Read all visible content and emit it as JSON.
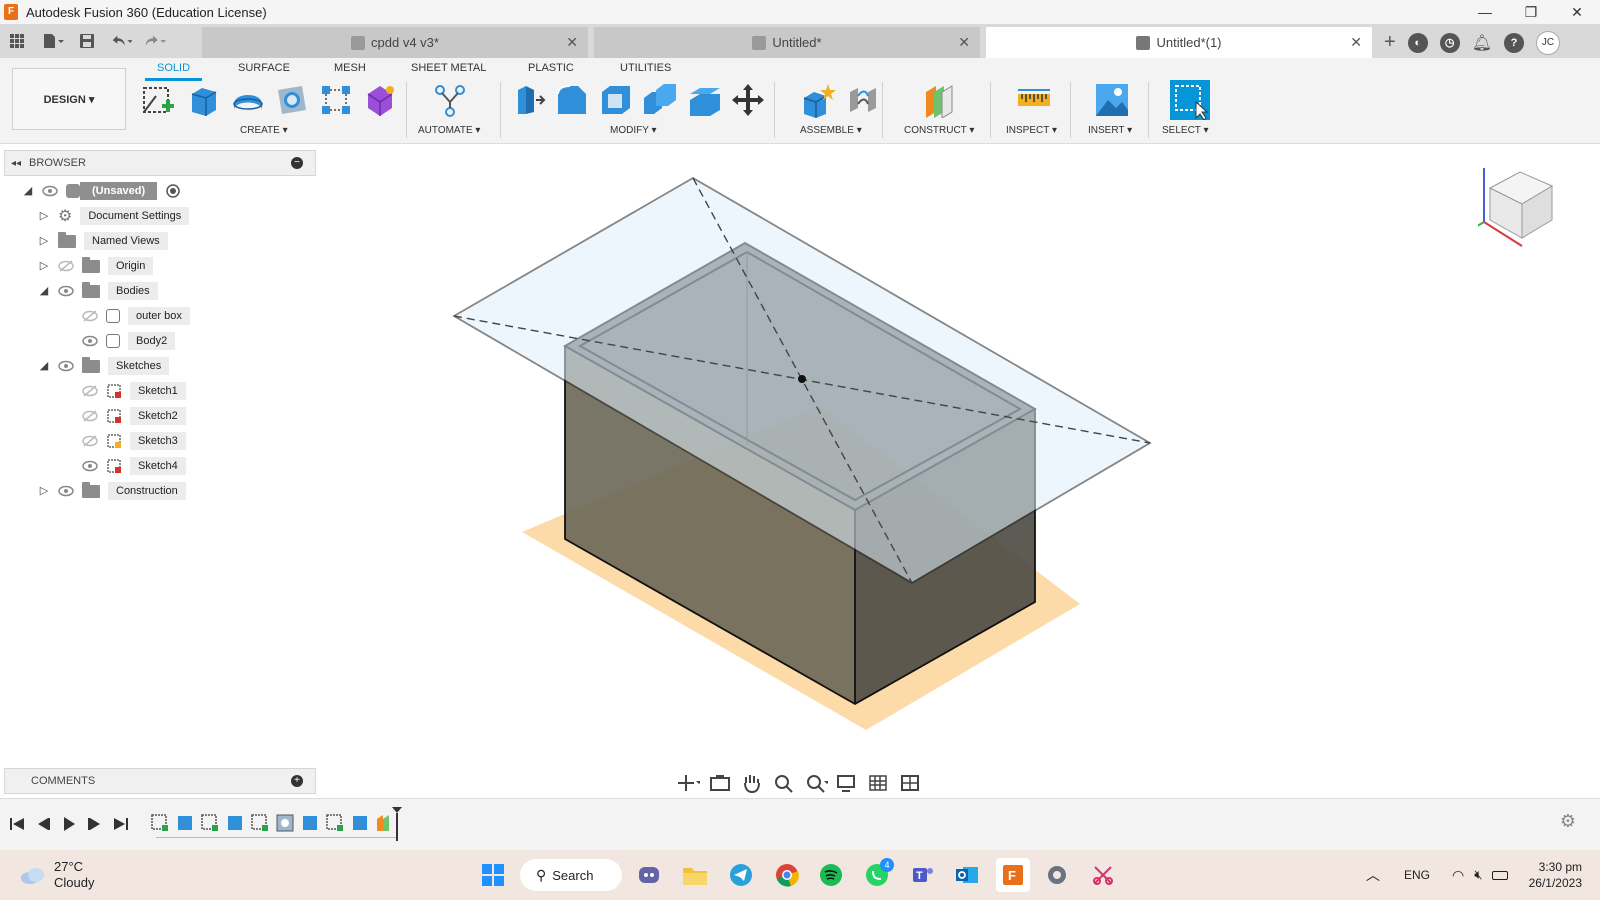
{
  "window": {
    "title": "Autodesk Fusion 360 (Education License)",
    "minimize": "—",
    "restore": "❐",
    "close": "✕"
  },
  "tabs": [
    {
      "label": "cpdd v4 v3*",
      "close": "✕"
    },
    {
      "label": "Untitled*",
      "close": "✕"
    },
    {
      "label": "Untitled*(1)",
      "close": "✕"
    }
  ],
  "ribbon": {
    "workspace": "DESIGN ▾",
    "tabs": [
      "SOLID",
      "SURFACE",
      "MESH",
      "SHEET METAL",
      "PLASTIC",
      "UTILITIES"
    ],
    "groups": [
      "CREATE ▾",
      "AUTOMATE ▾",
      "MODIFY ▾",
      "ASSEMBLE ▾",
      "CONSTRUCT ▾",
      "INSPECT ▾",
      "INSERT ▾",
      "SELECT ▾"
    ]
  },
  "browser": {
    "title": "BROWSER",
    "items": [
      {
        "label": "(Unsaved)"
      },
      {
        "label": "Document Settings"
      },
      {
        "label": "Named Views"
      },
      {
        "label": "Origin"
      },
      {
        "label": "Bodies"
      },
      {
        "label": "outer box"
      },
      {
        "label": "Body2"
      },
      {
        "label": "Sketches"
      },
      {
        "label": "Sketch1"
      },
      {
        "label": "Sketch2"
      },
      {
        "label": "Sketch3"
      },
      {
        "label": "Sketch4"
      },
      {
        "label": "Construction"
      }
    ]
  },
  "comments": {
    "title": "COMMENTS"
  },
  "taskbar": {
    "temp": "27°C",
    "condition": "Cloudy",
    "search": "Search",
    "lang": "ENG",
    "time": "3:30 pm",
    "date": "26/1/2023",
    "teams_badge": "4"
  },
  "user": {
    "initials": "JC"
  },
  "colors": {
    "accent": "#0696d7",
    "plane": "#dff0fb",
    "ground": "#fbd59a",
    "body": "#5f5f5f"
  }
}
